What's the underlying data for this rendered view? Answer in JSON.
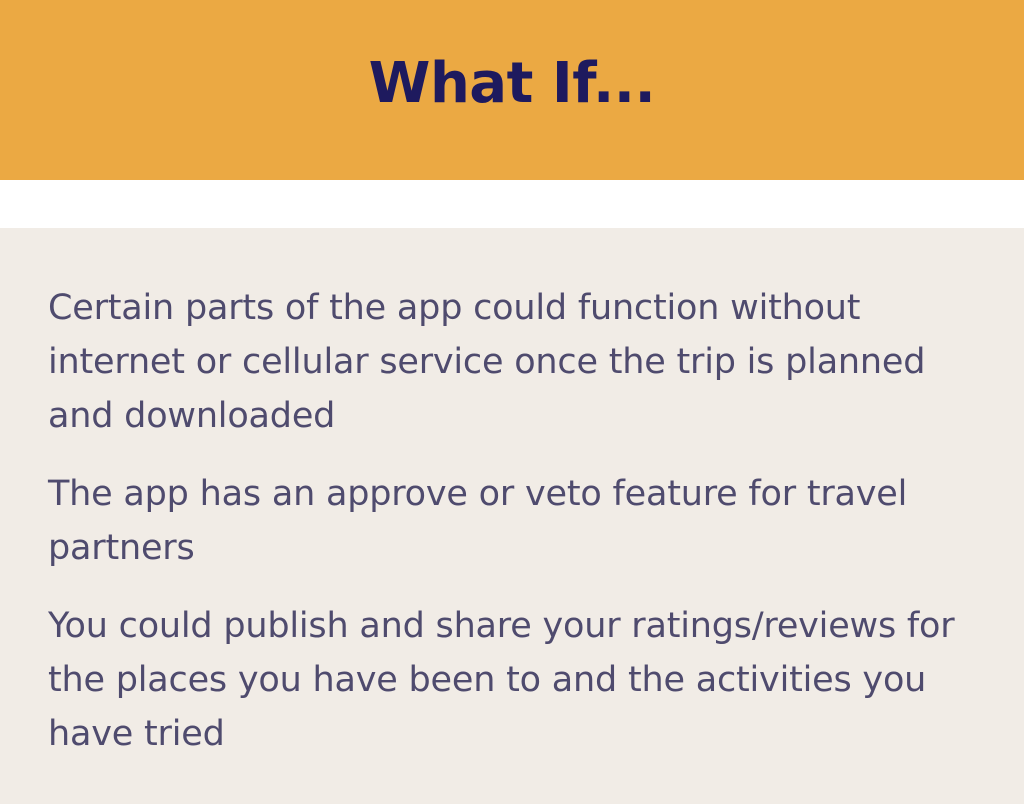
{
  "colors": {
    "header_bg": "#EBA943",
    "title_text": "#1E1A5E",
    "content_bg": "#F1ECE6",
    "body_text": "#4F4B6E"
  },
  "header": {
    "title": "What If..."
  },
  "items": [
    "Certain parts of the app could function without internet or cellular service once the trip is planned and downloaded",
    "The app has an approve or veto feature for travel partners",
    "You could publish and share your ratings/reviews for the places you have been to and the activities you have tried"
  ]
}
